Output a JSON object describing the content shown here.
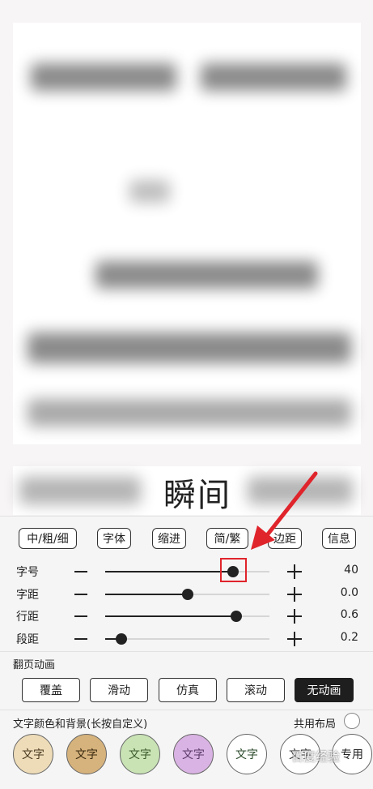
{
  "reader": {
    "visible_text": "瞬间"
  },
  "toolbar": [
    {
      "label": "中/粗/细"
    },
    {
      "label": "字体"
    },
    {
      "label": "缩进"
    },
    {
      "label": "简/繁"
    },
    {
      "label": "边距"
    },
    {
      "label": "信息"
    }
  ],
  "sliders": [
    {
      "label": "字号",
      "value": "40",
      "fraction": 0.78
    },
    {
      "label": "字距",
      "value": "0.0",
      "fraction": 0.5
    },
    {
      "label": "行距",
      "value": "0.6",
      "fraction": 0.8
    },
    {
      "label": "段距",
      "value": "0.2",
      "fraction": 0.1
    }
  ],
  "page_animation": {
    "title": "翻页动画",
    "options": [
      {
        "label": "覆盖"
      },
      {
        "label": "滑动"
      },
      {
        "label": "仿真"
      },
      {
        "label": "滚动"
      },
      {
        "label": "无动画",
        "selected": true
      }
    ]
  },
  "color_section": {
    "title": "文字颜色和背景(长按自定义)",
    "toggle_label": "共用布局",
    "swatches": [
      {
        "label": "文字",
        "bg": "#eedcb8",
        "fg": "#4a3a20"
      },
      {
        "label": "文字",
        "bg": "#d6b27c",
        "fg": "#3a2a10"
      },
      {
        "label": "文字",
        "bg": "#c9e3b5",
        "fg": "#3a5a2a"
      },
      {
        "label": "文字",
        "bg": "#d9b3e3",
        "fg": "#5a3a6a"
      },
      {
        "label": "文字",
        "bg": "#ffffff",
        "fg": "#2a4a2a"
      },
      {
        "label": "文字",
        "bg": "#ffffff",
        "fg": "#333333"
      },
      {
        "label": "专用",
        "bg": "#ffffff",
        "fg": "#222222"
      }
    ]
  },
  "annotation_color": "#e0242b",
  "watermark": "百度经验"
}
